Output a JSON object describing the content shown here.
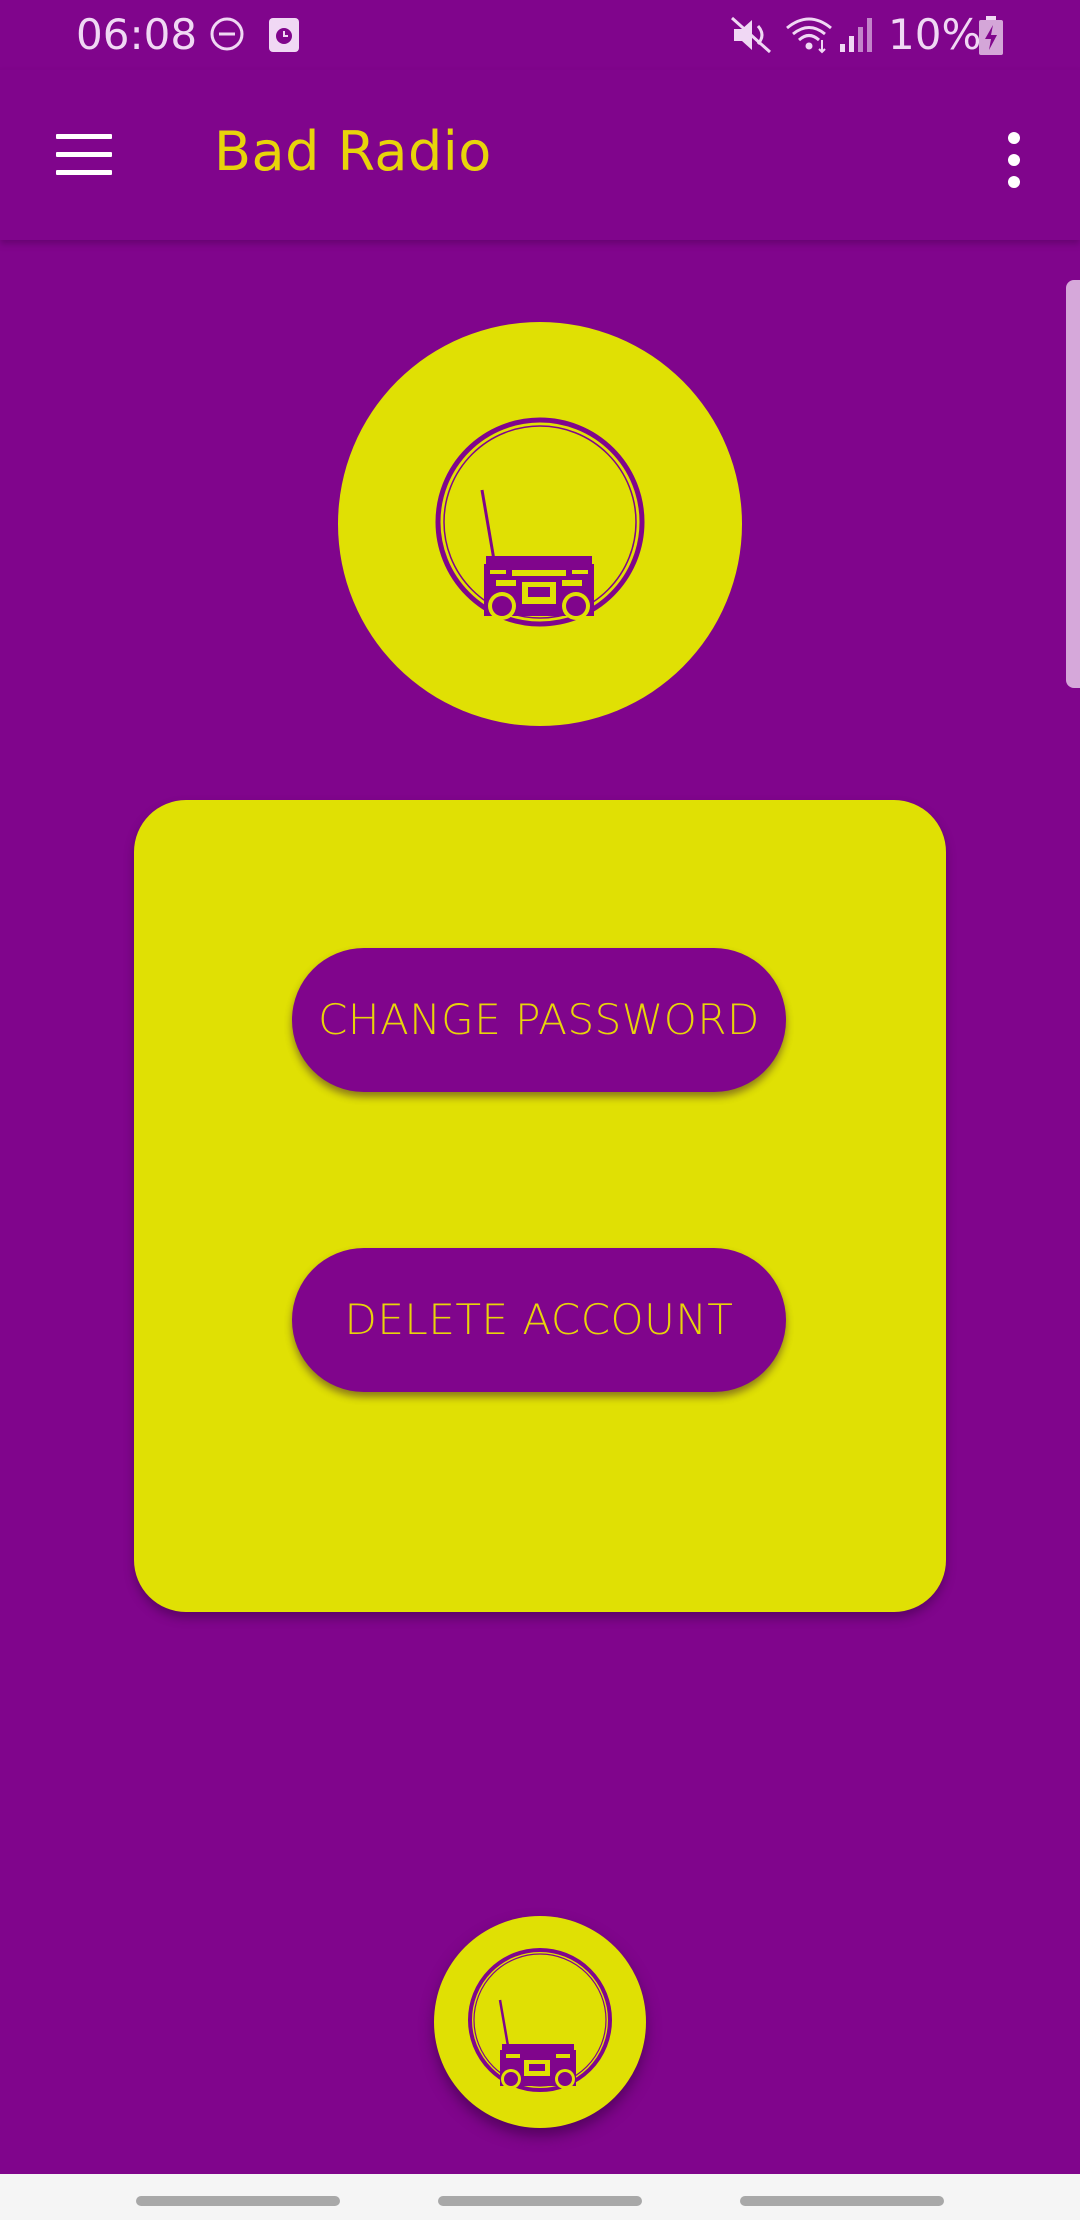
{
  "status_bar": {
    "time": "06:08",
    "battery_text": "10%",
    "icons": [
      "do-not-disturb-icon",
      "app-notification-icon",
      "mute-icon",
      "wifi-icon",
      "cell-signal-icon",
      "battery-charging-icon"
    ]
  },
  "app_bar": {
    "title": "Bad Radio",
    "menu_icon": "hamburger-menu-icon",
    "overflow_icon": "more-vert-icon"
  },
  "logo": {
    "icon": "boombox-icon"
  },
  "card": {
    "change_password_label": "CHANGE PASSWORD",
    "delete_account_label": "DELETE ACCOUNT"
  },
  "fab": {
    "icon": "boombox-icon"
  },
  "colors": {
    "background": "#80058c",
    "accent_yellow": "#e0e004",
    "title_yellow": "#e8d40a",
    "status_text": "#f0d8f4"
  }
}
